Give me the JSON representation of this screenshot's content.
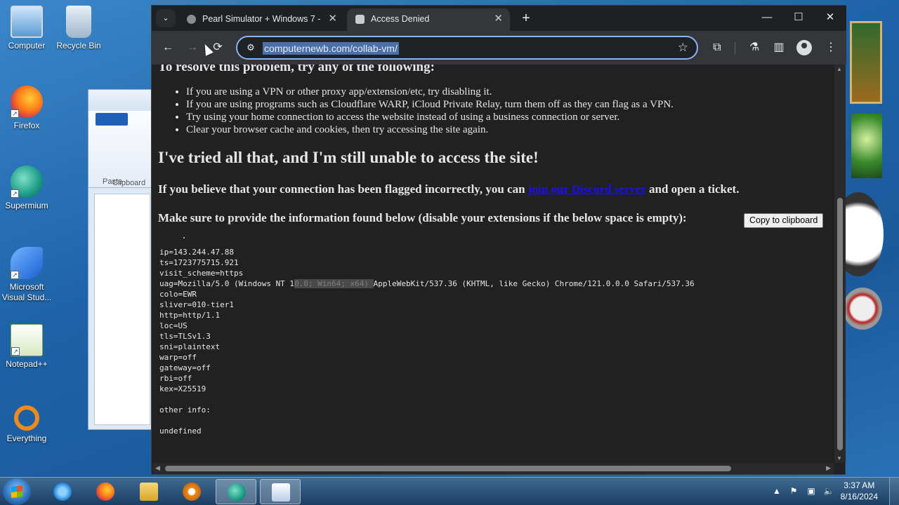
{
  "desktop": {
    "icons": [
      {
        "label": "Computer"
      },
      {
        "label": "Recycle Bin"
      },
      {
        "label": "Firefox"
      },
      {
        "label": "Supermium"
      },
      {
        "label": "Microsoft Visual Stud..."
      },
      {
        "label": "Notepad++"
      },
      {
        "label": "Everything"
      }
    ],
    "bg_window": {
      "paste": "Paste",
      "clipboard": "Clipboard"
    }
  },
  "browser": {
    "tabs": [
      {
        "title": "Pearl Simulator + Windows 7 -",
        "active": false
      },
      {
        "title": "Access Denied",
        "active": true
      }
    ],
    "new_tab": "+",
    "window_controls": {
      "minimize": "—",
      "maximize": "☐",
      "close": "✕"
    },
    "url": "computernewb.com/collab-vm/",
    "icons": {
      "back": "←",
      "forward": "→",
      "reload": "⟳",
      "site_info": "⚙",
      "bookmark": "☆",
      "extensions": "⧉",
      "labs": "⚗",
      "side_panel": "▥",
      "menu": "⋮",
      "tab_search": "⌄",
      "tab_close": "✕"
    }
  },
  "page": {
    "cut_heading": "To resolve this problem, try any of the following:",
    "tips": [
      "If you are using a VPN or other proxy app/extension/etc, try disabling it.",
      "If you are using programs such as Cloudflare WARP, iCloud Private Relay, turn them off as they can flag as a VPN.",
      "Try using your home connection to access the website instead of using a business connection or server.",
      "Clear your browser cache and cookies, then try accessing the site again."
    ],
    "heading": "I've tried all that, and I'm still unable to access the site!",
    "flag_text_before": "If you believe that your connection has been flagged incorrectly, you can ",
    "flag_link": "join our Discord server",
    "flag_text_after": " and open a ticket.",
    "provide_text": "Make sure to provide the information found below (disable your extensions if the below space is empty):",
    "copy_button": "Copy to clipboard",
    "info_lines": [
      "ip=143.244.47.88",
      "ts=1723775715.921",
      "visit_scheme=https",
      "colo=EWR",
      "sliver=010-tier1",
      "http=http/1.1",
      "loc=US",
      "tls=TLSv1.3",
      "sni=plaintext",
      "warp=off",
      "gateway=off",
      "rbi=off",
      "kex=X25519",
      "",
      "other info:",
      "",
      "undefined"
    ],
    "uag_prefix": "uag=Mozilla/5.0 (Windows NT 1",
    "uag_highlight": "0.0; Win64; x64) ",
    "uag_suffix": "AppleWebKit/537.36 (KHTML, like Gecko) Chrome/121.0.0.0 Safari/537.36"
  },
  "taskbar": {
    "time": "3:37 AM",
    "date": "8/16/2024",
    "tray_icons": {
      "show_hidden": "▲",
      "flag": "⚑",
      "network": "▣",
      "volume": "🔈"
    }
  },
  "colors": {
    "page_bg": "#212121",
    "link": "#1a0dff",
    "omnibox_focus": "#8ab4f8"
  }
}
